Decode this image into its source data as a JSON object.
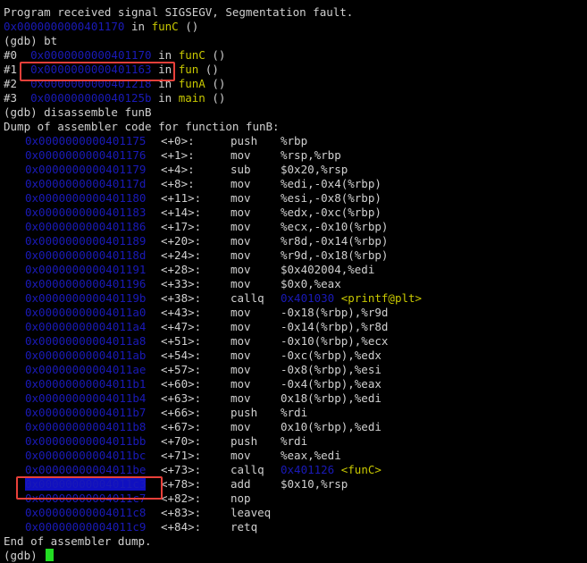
{
  "signal_line": "Program received signal SIGSEGV, Segmentation fault.",
  "crash": {
    "addr": "0x0000000000401170",
    "in": " in ",
    "fn": "funC",
    "args": " ()"
  },
  "bt_cmd": "(gdb) bt",
  "frames": [
    {
      "num": "#0  ",
      "addr": "0x0000000000401170",
      "in": " in ",
      "fn": "funC",
      "args": " ()"
    },
    {
      "num": "#1  ",
      "addr": "0x0000000000401163",
      "in": " in ",
      "fn": "fun",
      "args": " ()"
    },
    {
      "num": "#2  ",
      "addr": "0x0000000000401218",
      "in": " in ",
      "fn": "funA",
      "args": " ()"
    },
    {
      "num": "#3  ",
      "addr": "0x000000000040125b",
      "in": " in ",
      "fn": "main",
      "args": " ()"
    }
  ],
  "disas_cmd": "(gdb) disassemble funB",
  "dump_header": "Dump of assembler code for function funB:",
  "instructions": [
    {
      "addr": "0x0000000000401175",
      "off": "<+0>:",
      "mn": "push",
      "op": "%rbp"
    },
    {
      "addr": "0x0000000000401176",
      "off": "<+1>:",
      "mn": "mov",
      "op": "%rsp,%rbp"
    },
    {
      "addr": "0x0000000000401179",
      "off": "<+4>:",
      "mn": "sub",
      "op": "$0x20,%rsp"
    },
    {
      "addr": "0x000000000040117d",
      "off": "<+8>:",
      "mn": "mov",
      "op": "%edi,-0x4(%rbp)"
    },
    {
      "addr": "0x0000000000401180",
      "off": "<+11>:",
      "mn": "mov",
      "op": "%esi,-0x8(%rbp)"
    },
    {
      "addr": "0x0000000000401183",
      "off": "<+14>:",
      "mn": "mov",
      "op": "%edx,-0xc(%rbp)"
    },
    {
      "addr": "0x0000000000401186",
      "off": "<+17>:",
      "mn": "mov",
      "op": "%ecx,-0x10(%rbp)"
    },
    {
      "addr": "0x0000000000401189",
      "off": "<+20>:",
      "mn": "mov",
      "op": "%r8d,-0x14(%rbp)"
    },
    {
      "addr": "0x000000000040118d",
      "off": "<+24>:",
      "mn": "mov",
      "op": "%r9d,-0x18(%rbp)"
    },
    {
      "addr": "0x0000000000401191",
      "off": "<+28>:",
      "mn": "mov",
      "op": "$0x402004,%edi"
    },
    {
      "addr": "0x0000000000401196",
      "off": "<+33>:",
      "mn": "mov",
      "op": "$0x0,%eax"
    },
    {
      "addr": "0x000000000040119b",
      "off": "<+38>:",
      "mn": "callq",
      "op": "",
      "call_addr": "0x401030",
      "call_sym": " <printf@plt>"
    },
    {
      "addr": "0x00000000004011a0",
      "off": "<+43>:",
      "mn": "mov",
      "op": "-0x18(%rbp),%r9d"
    },
    {
      "addr": "0x00000000004011a4",
      "off": "<+47>:",
      "mn": "mov",
      "op": "-0x14(%rbp),%r8d"
    },
    {
      "addr": "0x00000000004011a8",
      "off": "<+51>:",
      "mn": "mov",
      "op": "-0x10(%rbp),%ecx"
    },
    {
      "addr": "0x00000000004011ab",
      "off": "<+54>:",
      "mn": "mov",
      "op": "-0xc(%rbp),%edx"
    },
    {
      "addr": "0x00000000004011ae",
      "off": "<+57>:",
      "mn": "mov",
      "op": "-0x8(%rbp),%esi"
    },
    {
      "addr": "0x00000000004011b1",
      "off": "<+60>:",
      "mn": "mov",
      "op": "-0x4(%rbp),%eax"
    },
    {
      "addr": "0x00000000004011b4",
      "off": "<+63>:",
      "mn": "mov",
      "op": "0x18(%rbp),%edi"
    },
    {
      "addr": "0x00000000004011b7",
      "off": "<+66>:",
      "mn": "push",
      "op": "%rdi"
    },
    {
      "addr": "0x00000000004011b8",
      "off": "<+67>:",
      "mn": "mov",
      "op": "0x10(%rbp),%edi"
    },
    {
      "addr": "0x00000000004011bb",
      "off": "<+70>:",
      "mn": "push",
      "op": "%rdi"
    },
    {
      "addr": "0x00000000004011bc",
      "off": "<+71>:",
      "mn": "mov",
      "op": "%eax,%edi"
    },
    {
      "addr": "0x00000000004011be",
      "off": "<+73>:",
      "mn": "callq",
      "op": "",
      "call_addr": "0x401126",
      "call_sym": " <funC>"
    },
    {
      "addr": "0x00000000004011c3",
      "off": "<+78>:",
      "mn": "add",
      "op": "$0x10,%rsp"
    },
    {
      "addr": "0x00000000004011c7",
      "off": "<+82>:",
      "mn": "nop",
      "op": ""
    },
    {
      "addr": "0x00000000004011c8",
      "off": "<+83>:",
      "mn": "leaveq",
      "op": ""
    },
    {
      "addr": "0x00000000004011c9",
      "off": "<+84>:",
      "mn": "retq",
      "op": ""
    }
  ],
  "dump_footer": "End of assembler dump.",
  "prompt": "(gdb) ",
  "colors": {
    "address": "#1a1ab8",
    "function": "#c8c800",
    "annotation_box": "#e8403a",
    "cursor": "#22dd22",
    "selection": "#1010c0"
  }
}
